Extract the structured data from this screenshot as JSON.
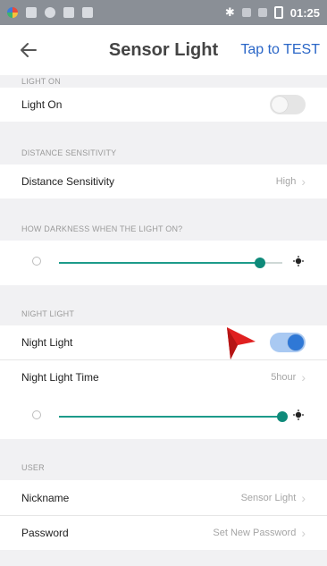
{
  "status_bar": {
    "time": "01:25"
  },
  "header": {
    "title": "Sensor Light",
    "test_label": "Tap to TEST"
  },
  "sections": {
    "light_on": {
      "header": "LIGHT ON",
      "row_label": "Light On",
      "toggle_on": false
    },
    "distance": {
      "header": "DISTANCE SENSITIVITY",
      "row_label": "Distance Sensitivity",
      "value": "High"
    },
    "darkness": {
      "header": "HOW DARKNESS WHEN THE LIGHT ON?",
      "slider_level": 0.9
    },
    "night_light": {
      "header": "NIGHT LIGHT",
      "row_label": "Night Light",
      "toggle_on": true,
      "time_label": "Night Light Time",
      "time_value": "5hour",
      "slider_level": 1.0
    },
    "user": {
      "header": "USER",
      "nickname_label": "Nickname",
      "nickname_value": "Sensor Light",
      "password_label": "Password",
      "password_value": "Set New Password"
    }
  },
  "colors": {
    "accent_blue": "#2a66c7",
    "slider_teal": "#1d9b8a",
    "toggle_on": "#2f78d6",
    "annotation_arrow": "#e02020"
  }
}
